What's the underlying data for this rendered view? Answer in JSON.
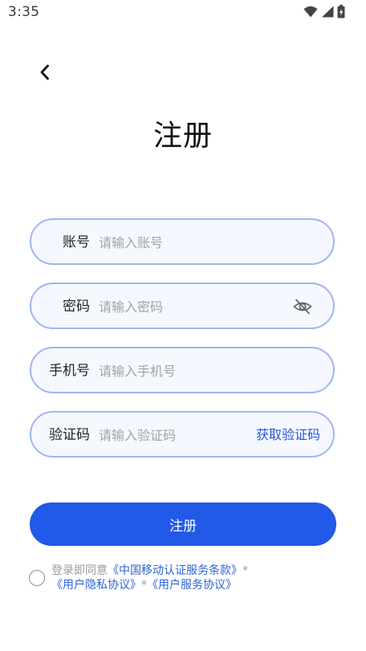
{
  "status_bar": {
    "time": "3:35"
  },
  "page": {
    "title": "注册"
  },
  "form": {
    "account": {
      "label": "账号",
      "placeholder": "请输入账号"
    },
    "password": {
      "label": "密码",
      "placeholder": "请输入密码"
    },
    "phone": {
      "label": "手机号",
      "placeholder": "请输入手机号"
    },
    "code": {
      "label": "验证码",
      "placeholder": "请输入验证码",
      "action_label": "获取验证码"
    },
    "submit_label": "注册"
  },
  "agreement": {
    "prefix": "登录即同意",
    "terms_link": "《中国移动认证服务条款》",
    "separator": "*",
    "privacy_link": "《用户隐私协议》",
    "service_link": "《用户服务协议》"
  },
  "icons": {
    "back": "chevron-left-icon",
    "password_toggle": "eye-off-icon",
    "wifi": "wifi-icon",
    "signal": "signal-icon",
    "battery": "battery-icon"
  },
  "colors": {
    "primary": "#2159e8",
    "link": "#2d63d6",
    "field_border": "#9db7ef",
    "field_background": "#f5f8fe"
  }
}
